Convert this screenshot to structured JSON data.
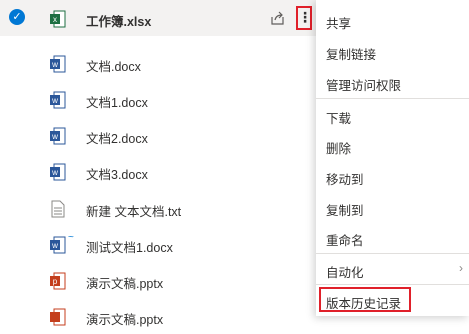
{
  "files": [
    {
      "name": "工作簿.xlsx",
      "type": "excel",
      "selected": true
    },
    {
      "name": "文档.docx",
      "type": "word"
    },
    {
      "name": "文档1.docx",
      "type": "word"
    },
    {
      "name": "文档2.docx",
      "type": "word"
    },
    {
      "name": "文档3.docx",
      "type": "word"
    },
    {
      "name": "新建 文本文档.txt",
      "type": "text"
    },
    {
      "name": "测试文档1.docx",
      "type": "word",
      "is_new": true
    },
    {
      "name": "演示文稿.pptx",
      "type": "ppt"
    },
    {
      "name": "演示文稿.pptx",
      "type": "ppt",
      "partial": true
    }
  ],
  "new_mark": "~",
  "context_menu": {
    "items": [
      {
        "label": "共享"
      },
      {
        "label": "复制链接"
      },
      {
        "label": "管理访问权限"
      },
      {
        "label": "下载"
      },
      {
        "label": "删除"
      },
      {
        "label": "移动到"
      },
      {
        "label": "复制到"
      },
      {
        "label": "重命名"
      },
      {
        "label": "自动化",
        "has_submenu": true
      },
      {
        "label": "版本历史记录",
        "highlighted": true
      }
    ]
  },
  "colors": {
    "accent": "#0078d4",
    "highlight_border": "#e0202a",
    "excel": "#1d6f42",
    "word": "#2b579a",
    "ppt": "#c43e1c"
  },
  "icons": {
    "check": "✓",
    "more": "⋮",
    "chevron": "›"
  }
}
